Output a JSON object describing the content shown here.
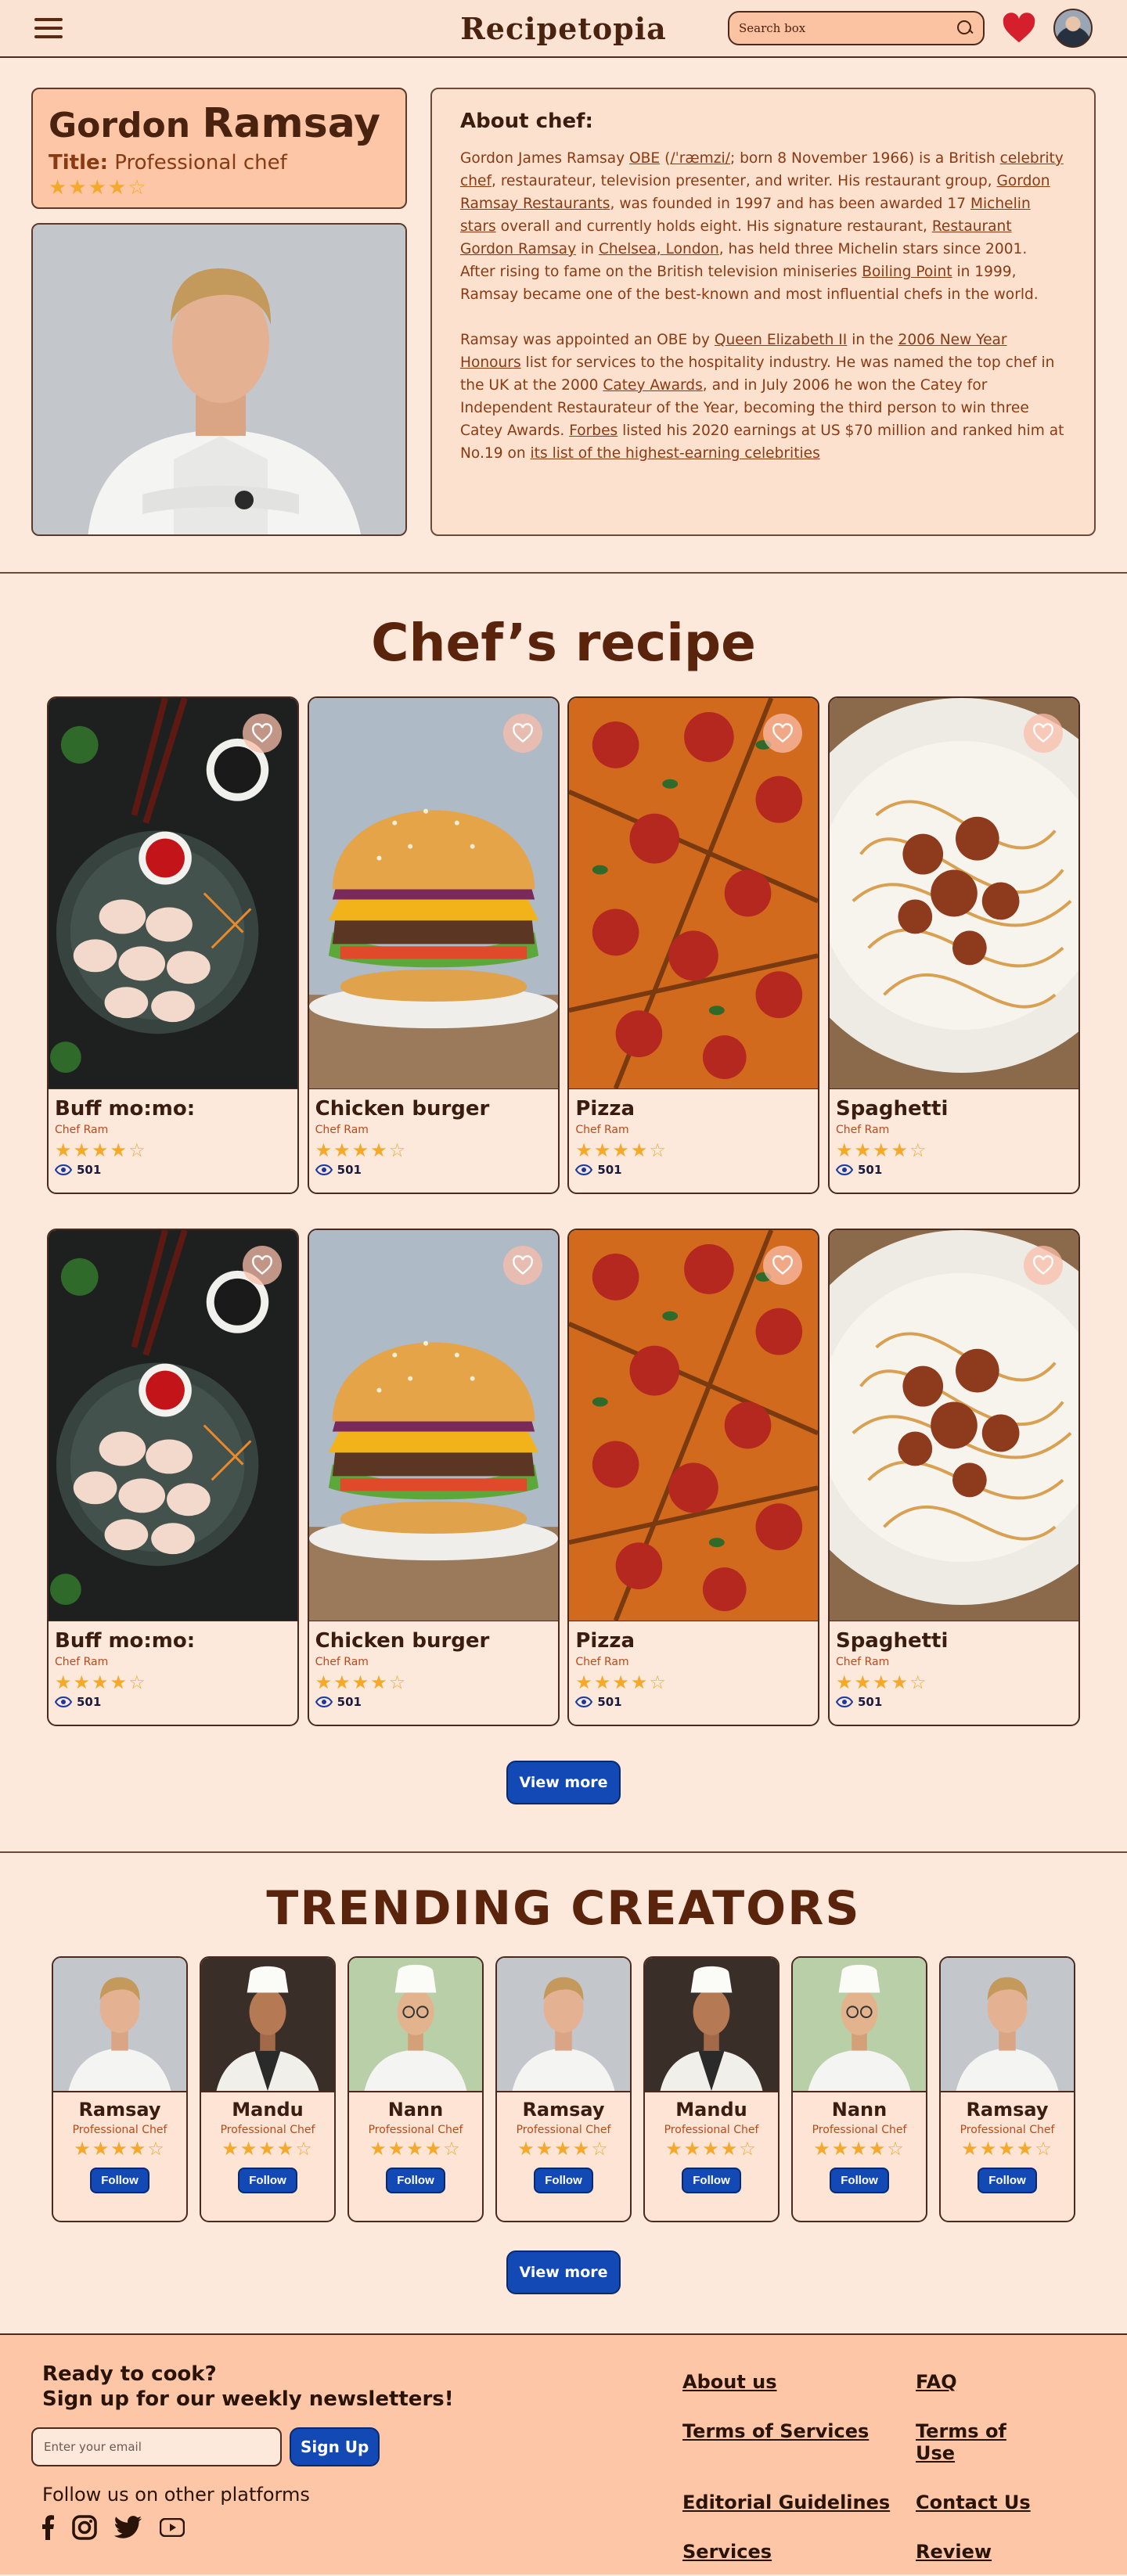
{
  "nav": {
    "brand": "Recipetopia",
    "search_placeholder": "Search box"
  },
  "chef": {
    "first_name": "Gordon",
    "last_name": "Ramsay",
    "title_label": "Title:",
    "title_value": "Professional chef",
    "rating": "★★★★☆",
    "about_heading": "About chef:"
  },
  "recipes_section": {
    "title": "Chef’s recipe",
    "view_more": "View more",
    "items": [
      {
        "name": "Buff mo:mo:",
        "chef": "Chef Ram",
        "rating": "★★★★☆",
        "views": "501"
      },
      {
        "name": "Chicken burger",
        "chef": "Chef Ram",
        "rating": "★★★★☆",
        "views": "501"
      },
      {
        "name": "Pizza",
        "chef": "Chef Ram",
        "rating": "★★★★☆",
        "views": "501"
      },
      {
        "name": "Spaghetti",
        "chef": "Chef Ram",
        "rating": "★★★★☆",
        "views": "501"
      },
      {
        "name": "Buff mo:mo:",
        "chef": "Chef Ram",
        "rating": "★★★★☆",
        "views": "501"
      },
      {
        "name": "Chicken burger",
        "chef": "Chef Ram",
        "rating": "★★★★☆",
        "views": "501"
      },
      {
        "name": "Pizza",
        "chef": "Chef Ram",
        "rating": "★★★★☆",
        "views": "501"
      },
      {
        "name": "Spaghetti",
        "chef": "Chef Ram",
        "rating": "★★★★☆",
        "views": "501"
      }
    ]
  },
  "creators_section": {
    "title": "TRENDING CREATORS",
    "view_more": "View more",
    "follow_label": "Follow",
    "items": [
      {
        "name": "Ramsay",
        "title": "Professional Chef",
        "rating": "★★★★☆"
      },
      {
        "name": "Mandu",
        "title": "Professional Chef",
        "rating": "★★★★☆"
      },
      {
        "name": "Nann",
        "title": "Professional Chef",
        "rating": "★★★★☆"
      },
      {
        "name": "Ramsay",
        "title": "Professional Chef",
        "rating": "★★★★☆"
      },
      {
        "name": "Mandu",
        "title": "Professional Chef",
        "rating": "★★★★☆"
      },
      {
        "name": "Nann",
        "title": "Professional Chef",
        "rating": "★★★★☆"
      },
      {
        "name": "Ramsay",
        "title": "Professional Chef",
        "rating": "★★★★☆"
      }
    ]
  },
  "footer": {
    "cta_line1": "Ready to cook?",
    "cta_line2": "Sign up for our weekly newsletters!",
    "email_placeholder": "Enter your email",
    "signup_label": "Sign Up",
    "follow_text": "Follow us on other platforms",
    "links": {
      "about": "About us",
      "faq": "FAQ",
      "terms_services": "Terms of Services",
      "terms_use": "Terms of Use",
      "editorial": "Editorial Guidelines",
      "contact": "Contact Us",
      "services": "Services",
      "review": "Review"
    }
  },
  "colors": {
    "accent": "#1349b5",
    "heart": "#d61f2c",
    "star": "#f4a92a",
    "brand_text": "#4a2210"
  }
}
